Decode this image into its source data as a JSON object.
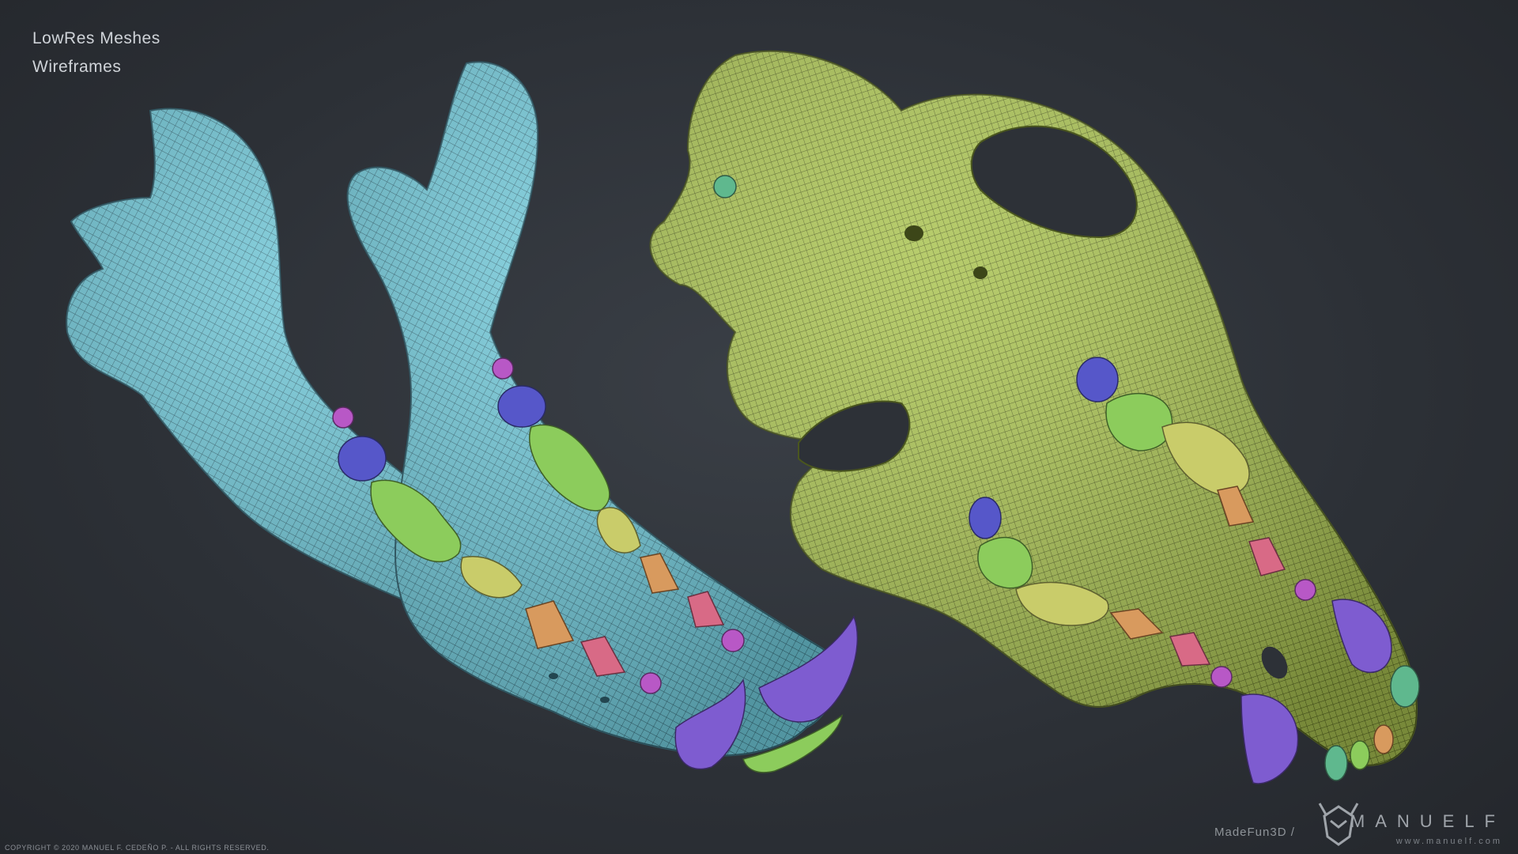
{
  "captions": {
    "line1": "LowRes Meshes",
    "line2": "Wireframes"
  },
  "footer": {
    "copyright": "COPYRIGHT © 2020 MANUEL F. CEDEÑO P. - ALL RIGHTS RESERVED.",
    "brand_prefix": "MadeFun3D /",
    "brand_name": "MANUELF",
    "brand_url": "www.manuelf.com"
  },
  "colors": {
    "jaw_mesh": "#6cc3d4",
    "skull_mesh": "#a9c24e",
    "canine_teeth": "#7e5cd0",
    "incisors_small": "#b858c6",
    "molars_blue": "#5657c9",
    "molars_green": "#8ccc5c",
    "premolars_yellow": "#c9cc6a",
    "premolars_orange": "#d89a5e",
    "premolars_pink": "#d86a86"
  }
}
